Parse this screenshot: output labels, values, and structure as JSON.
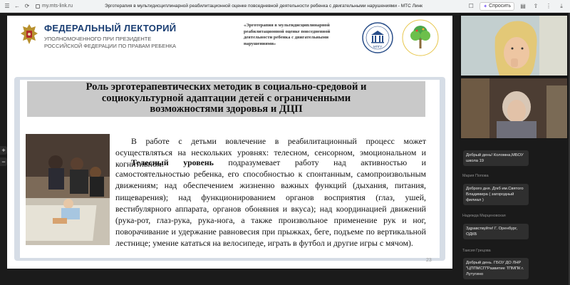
{
  "browser": {
    "url": "my.mts-link.ru",
    "page_title": "Эрготерапия в мультидисциплинарной реабилитационной оценке повседневной деятельности ребенка с двигательными нарушениями - МТС Линк",
    "ask_label": "Спросить"
  },
  "zoom": {
    "plus": "+",
    "minus": "−"
  },
  "slide": {
    "lect_title": "ФЕДЕРАЛЬНЫЙ ЛЕКТОРИЙ",
    "lect_sub_1": "УПОЛНОМОЧЕННОГО ПРИ ПРЕЗИДЕНТЕ",
    "lect_sub_2": "РОССИЙСКОЙ ФЕДЕРАЦИИ ПО ПРАВАМ РЕБЕНКА",
    "topic": "«Эрготерапия в мультидисциплинарной реабилитационной оценке повседневной деятельности ребенка с двигательными нарушениями»",
    "logo1_text": "МПГУ",
    "title_line_1": "Роль эрготерапевтических методик в социально-средовой и",
    "title_line_2": "социокультурной адаптации детей с ограниченными",
    "title_line_3": "возможностями здоровья и ДЦП",
    "para1": "В работе с детьми вовлечение в реабилитационный процесс может осуществляться на нескольких уровнях: телесном, сенсорном, эмоциональном и когнитивном.",
    "para2_bold": "Телесный уровень",
    "para2_rest": " подразумевает работу над активностью и самостоятельностью ребенка, его способностью к спонтанным, самопроизвольным движениям; над обеспечением жизненно важных функций (дыхания, питания, пищеварения); над функционированием органов восприятия (глаз, ушей, вестибулярного аппарата, органов обоняния и вкуса); над координацией движений (рука-рот, глаз-рука, рука-нога, а также произвольное применение рук и ног, поворачивание и удержание равновесия при прыжках, беге, подъеме по вертикальной лестнице; умение кататься на велосипеде, играть в футбол и другие игры с мячом).",
    "page_number": "23"
  },
  "chat": [
    {
      "name": "",
      "message": "Добрый день! Коломна,МБОУ школа 19"
    },
    {
      "name": "Мария Попова",
      "message": "Доброго дня. Дгкб им.Святого Владимира ( загородный филиал )"
    },
    {
      "name": "Надежда Марценовская",
      "message": "Здравствуйте! Г. Оренбург, ОДКБ"
    },
    {
      "name": "Таисия Грецова",
      "message": "Добрый день. ГБОУ ДО ЛНР \"ЦППМСП\"Развитие ТПМПК г. Лутугино"
    }
  ]
}
